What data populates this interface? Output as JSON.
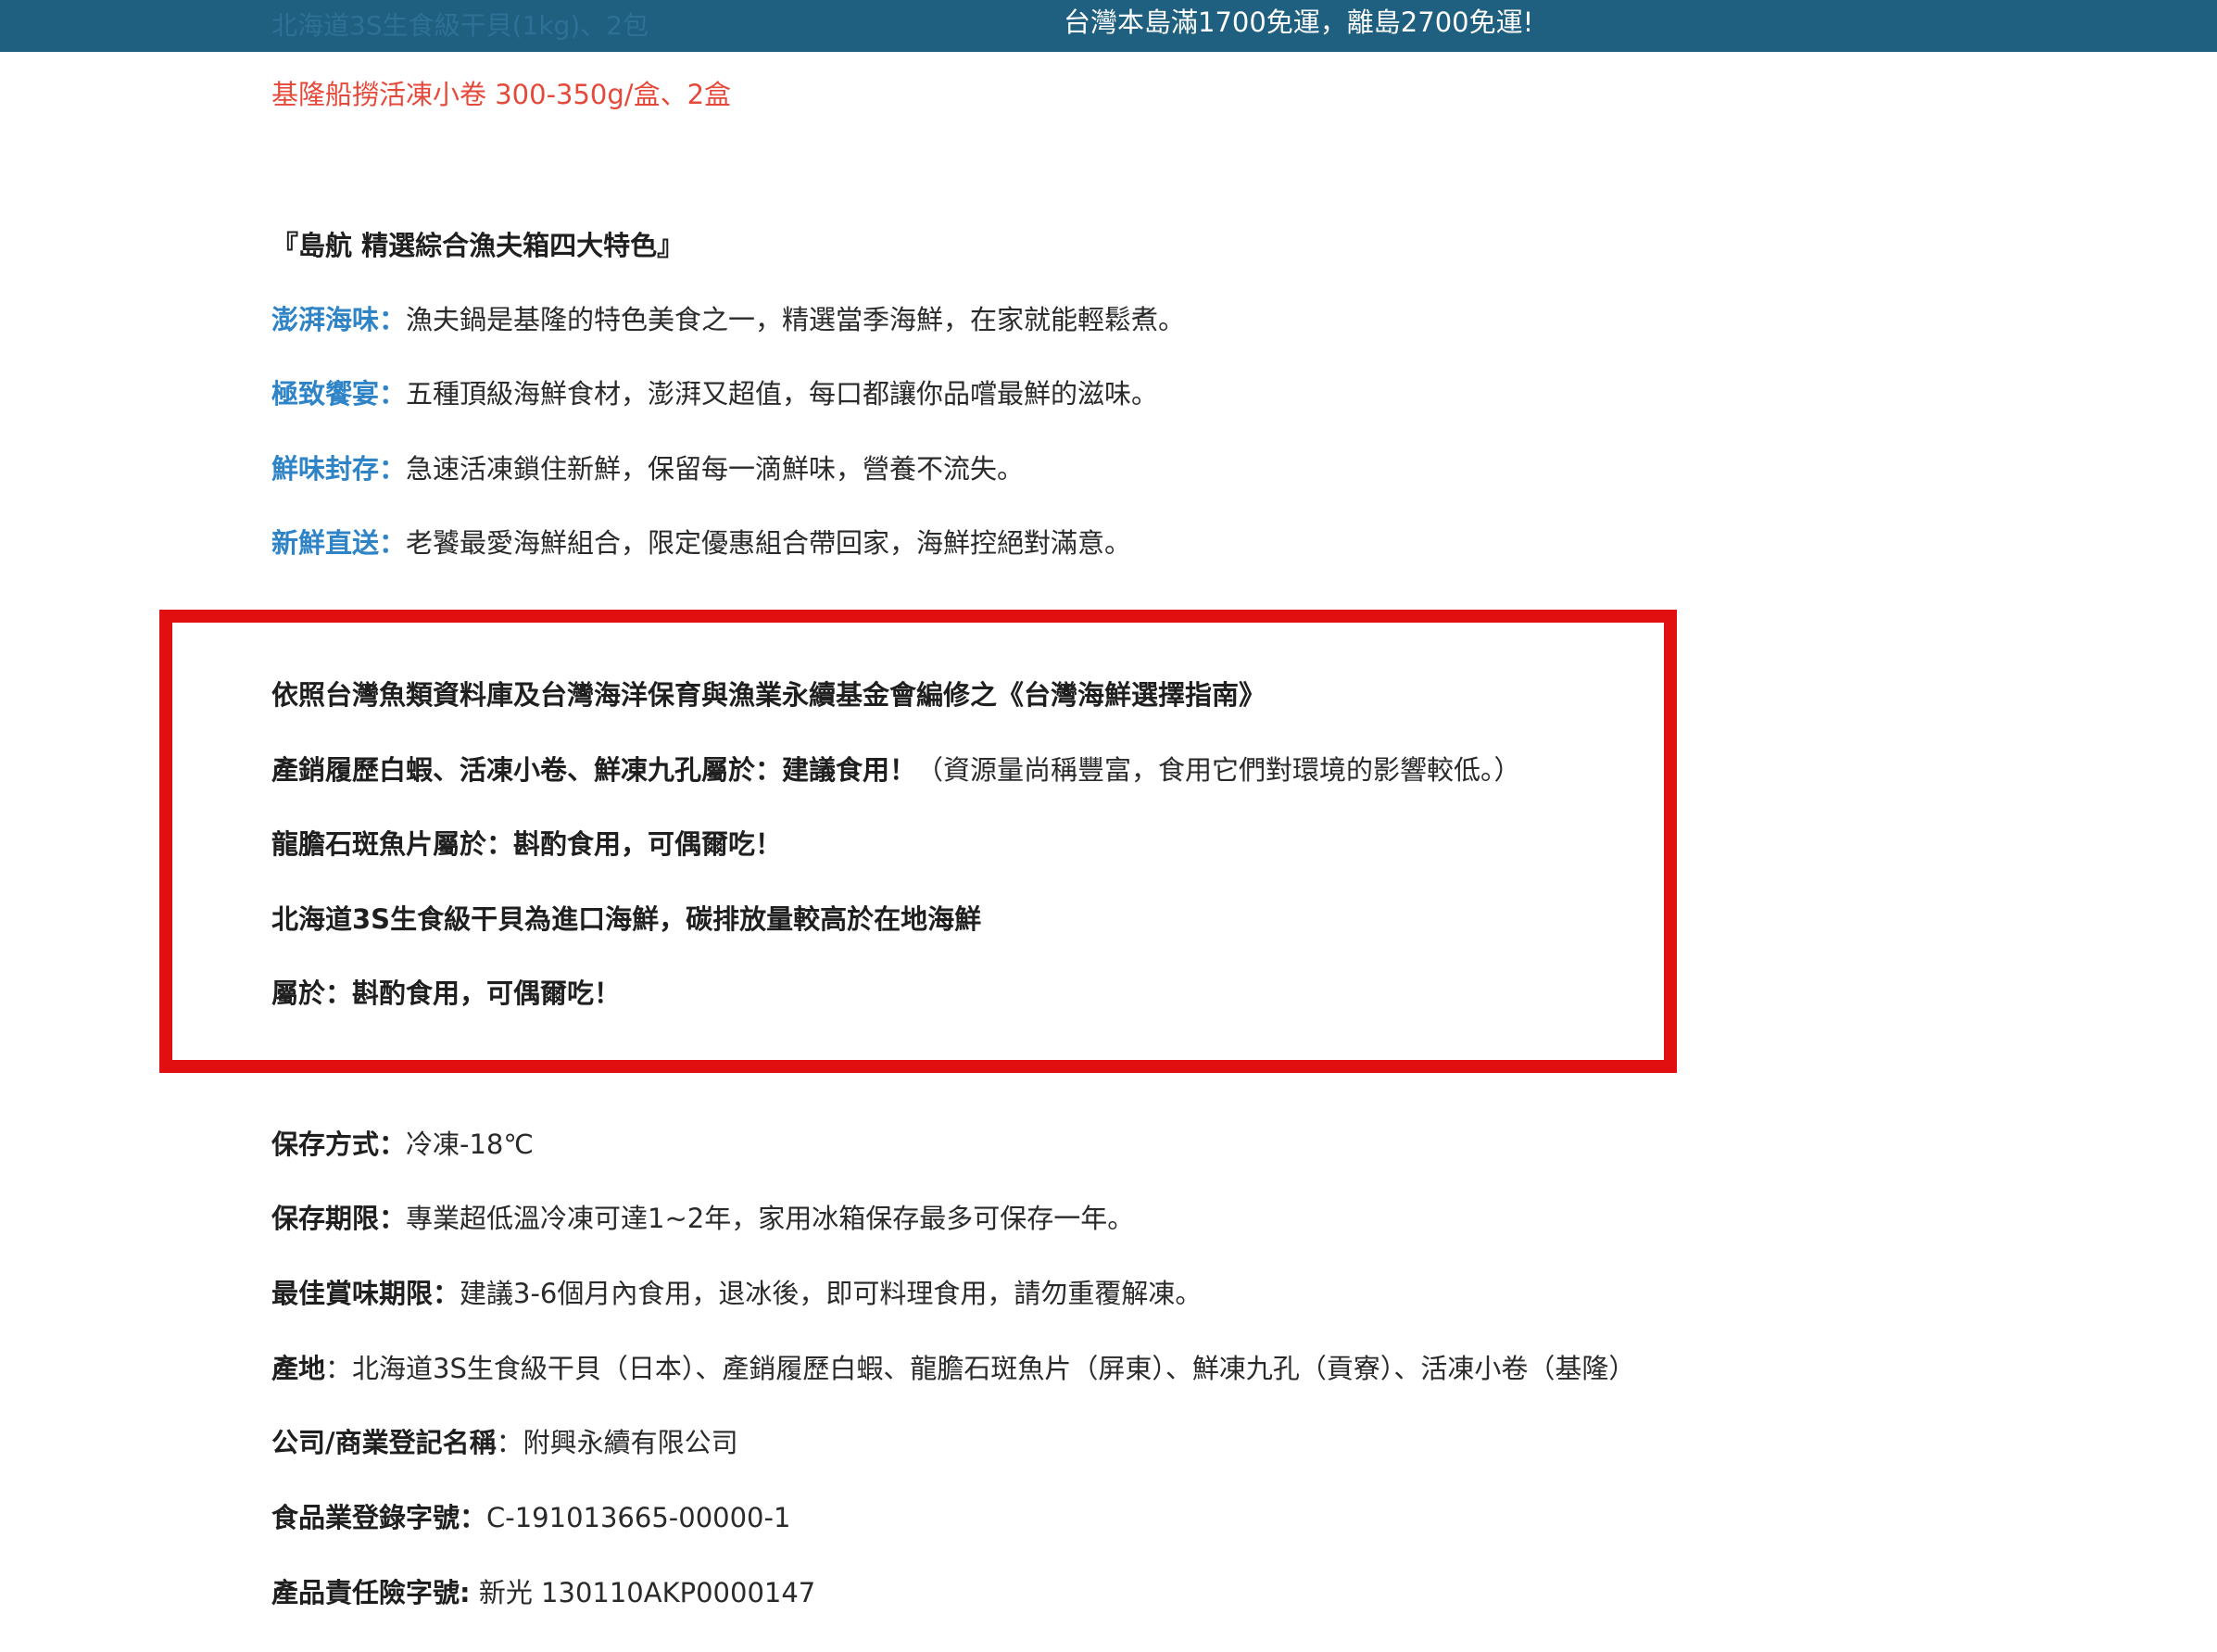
{
  "top_bar": {
    "partial_text": "北海道3S生食級干貝(1kg)、2包",
    "shipping_notice": "台灣本島滿1700免運，離島2700免運!"
  },
  "item_line": "基隆船撈活凍小卷 300-350g/盒、2盒",
  "features": {
    "heading": "『島航 精選綜合漁夫箱四大特色』",
    "items": [
      {
        "label": "澎湃海味：",
        "text": "漁夫鍋是基隆的特色美食之一，精選當季海鮮，在家就能輕鬆煮。"
      },
      {
        "label": "極致饗宴：",
        "text": "五種頂級海鮮食材，澎湃又超值，每口都讓你品嚐最鮮的滋味。"
      },
      {
        "label": "鮮味封存：",
        "text": "急速活凍鎖住新鮮，保留每一滴鮮味，營養不流失。"
      },
      {
        "label": "新鮮直送：",
        "text": "老饕最愛海鮮組合，限定優惠組合帶回家，海鮮控絕對滿意。"
      }
    ]
  },
  "notice": {
    "line1": "依照台灣魚類資料庫及台灣海洋保育與漁業永續基金會編修之《台灣海鮮選擇指南》",
    "line2_prefix": "產銷履歷白蝦、活凍小卷、鮮凍九孔屬於：",
    "line2_highlight": "建議食用！",
    "line2_suffix": "（資源量尚稱豐富，食用它們對環境的影響較低。）",
    "line3_prefix": "龍膽石斑魚片屬於：",
    "line3_highlight": "斟酌食用，可偶爾吃！",
    "line4": "北海道3S生食級干貝為進口海鮮，碳排放量較高於在地海鮮",
    "line5_prefix": "屬於：",
    "line5_highlight": "斟酌食用，可偶爾吃！"
  },
  "specs": [
    {
      "label": "保存方式：",
      "value": "冷凍-18℃"
    },
    {
      "label": "保存期限：",
      "value": "專業超低溫冷凍可達1~2年，家用冰箱保存最多可保存一年。"
    },
    {
      "label": "最佳賞味期限：",
      "value": "建議3-6個月內食用，退冰後，即可料理食用，請勿重覆解凍。"
    },
    {
      "label": "產地",
      "value": "：北海道3S生食級干貝（日本）、產銷履歷白蝦、龍膽石斑魚片（屏東）、鮮凍九孔（貢寮）、活凍小卷（基隆）"
    },
    {
      "label": "公司/商業登記名稱",
      "value": "：附興永續有限公司"
    },
    {
      "label": "食品業登錄字號：",
      "value": "C-191013665-00000-1"
    },
    {
      "label": "產品責任險字號:",
      "value": " 新光 130110AKP0000147"
    }
  ],
  "colors": {
    "top_bar": "#1f5f80",
    "accent_red": "#e5493a",
    "label_blue": "#2f84c7",
    "box_border": "#e10f0f"
  }
}
